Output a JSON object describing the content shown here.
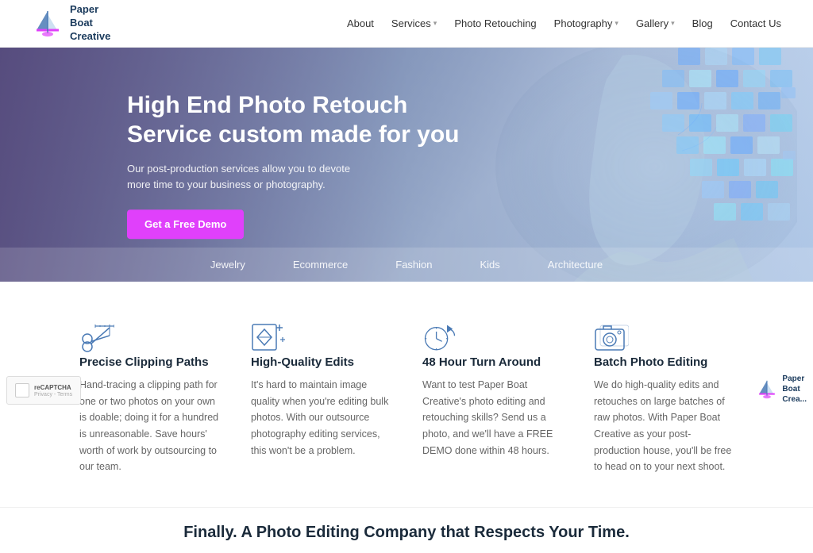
{
  "header": {
    "logo_line1": "Paper",
    "logo_line2": "Boat",
    "logo_line3": "Creative",
    "nav_items": [
      {
        "label": "About",
        "has_dropdown": false
      },
      {
        "label": "Services",
        "has_dropdown": true
      },
      {
        "label": "Photo Retouching",
        "has_dropdown": false
      },
      {
        "label": "Photography",
        "has_dropdown": true
      },
      {
        "label": "Gallery",
        "has_dropdown": true
      },
      {
        "label": "Blog",
        "has_dropdown": false
      },
      {
        "label": "Contact Us",
        "has_dropdown": false
      }
    ]
  },
  "hero": {
    "title": "High End Photo Retouch Service custom made for you",
    "subtitle": "Our post-production services allow you to devote more time to your business or photography.",
    "cta_label": "Get a Free Demo",
    "categories": [
      "Jewelry",
      "Ecommerce",
      "Fashion",
      "Kids",
      "Architecture"
    ]
  },
  "features": [
    {
      "icon": "scissors-icon",
      "title": "Precise Clipping Paths",
      "description": "Hand-tracing a clipping path for one or two photos on your own is doable; doing it for a hundred is unreasonable. Save hours' worth of work by outsourcing to our team."
    },
    {
      "icon": "diamond-icon",
      "title": "High-Quality Edits",
      "description": "It's hard to maintain image quality when you're editing bulk photos. With our outsource photography editing services, this won't be a problem."
    },
    {
      "icon": "clock-icon",
      "title": "48 Hour Turn Around",
      "description": "Want to test Paper Boat Creative's photo editing and retouching skills? Send us a photo, and we'll have a FREE DEMO done within 48 hours."
    },
    {
      "icon": "camera-icon",
      "title": "Batch Photo Editing",
      "description": "We do high-quality edits and retouches on large batches of raw photos. With Paper Boat Creative as your post-production house, you'll be free to head on to your next shoot."
    }
  ],
  "bottom_tagline": "Finally. A Photo Editing Company that Respects Your Time.",
  "footer": {
    "brand_line1": "Paper",
    "brand_line2": "Boat",
    "brand_line3": "Crea..."
  },
  "recaptcha": {
    "label": "reCAPTCHA",
    "sublabel": "Privacy - Terms"
  },
  "colors": {
    "accent": "#e040fb",
    "primary_text": "#1a2a3a",
    "nav_text": "#333",
    "hero_bg_start": "#7b6fa0",
    "icon_stroke": "#4a7ab5"
  }
}
